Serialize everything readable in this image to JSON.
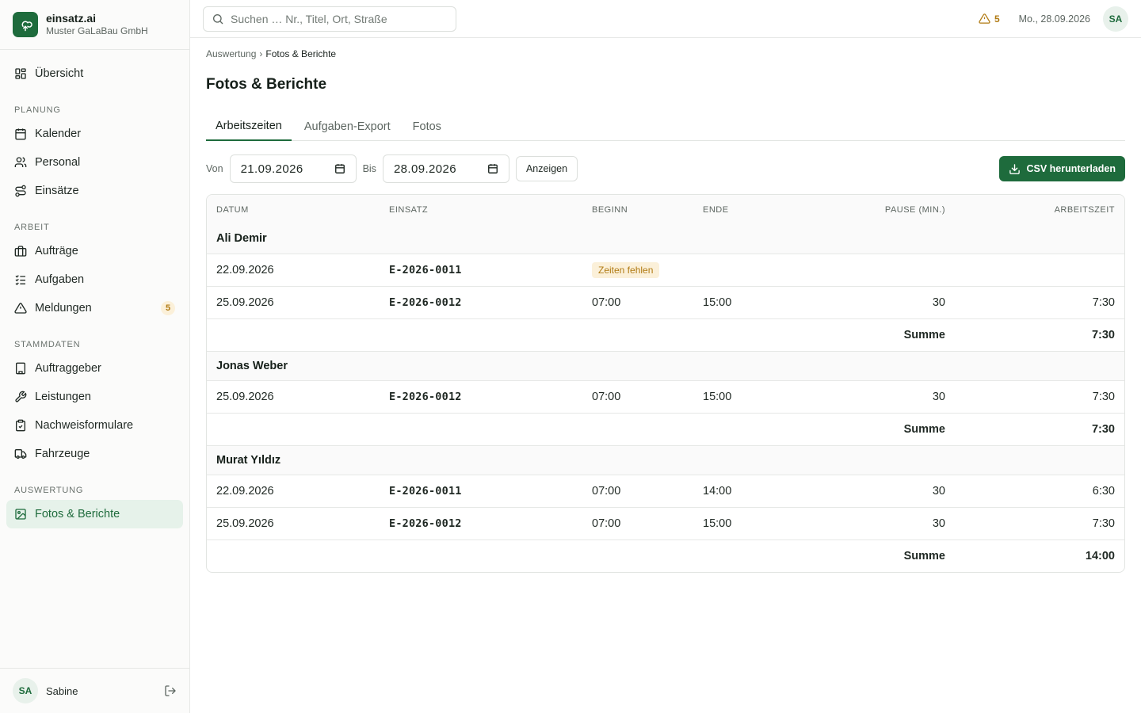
{
  "brand": {
    "name": "einsatz.ai",
    "company": "Muster GaLaBau GmbH"
  },
  "nav": {
    "overview": "Übersicht",
    "sections": {
      "planung": "PLANUNG",
      "arbeit": "ARBEIT",
      "stammdaten": "STAMMDATEN",
      "auswertung": "AUSWERTUNG"
    },
    "kalender": "Kalender",
    "personal": "Personal",
    "einsaetze": "Einsätze",
    "auftraege": "Aufträge",
    "aufgaben": "Aufgaben",
    "meldungen": "Meldungen",
    "meldungen_badge": "5",
    "auftraggeber": "Auftraggeber",
    "leistungen": "Leistungen",
    "nachweisformulare": "Nachweisformulare",
    "fahrzeuge": "Fahrzeuge",
    "fotos": "Fotos & Berichte"
  },
  "user": {
    "initials": "SA",
    "name": "Sabine"
  },
  "topbar": {
    "search_placeholder": "Suchen … Nr., Titel, Ort, Straße",
    "alert_count": "5",
    "date": "Mo., 28.09.2026"
  },
  "breadcrumb": {
    "parent": "Auswertung",
    "separator": "›",
    "current": "Fotos & Berichte"
  },
  "page_title": "Fotos & Berichte",
  "tabs": [
    "Arbeitszeiten",
    "Aufgaben-Export",
    "Fotos"
  ],
  "filters": {
    "from_label": "Von",
    "from_value": "21.09.2026",
    "to_label": "Bis",
    "to_value": "28.09.2026",
    "show_button": "Anzeigen",
    "csv_button": "CSV herunterladen"
  },
  "table": {
    "columns": [
      "DATUM",
      "EINSATZ",
      "BEGINN",
      "ENDE",
      "PAUSE (MIN.)",
      "ARBEITSZEIT"
    ],
    "sum_label": "Summe",
    "groups": [
      {
        "name": "Ali Demir",
        "rows": [
          {
            "datum": "22.09.2026",
            "einsatz": "E-2026-0011",
            "badge": "Zeiten fehlen",
            "beginn": "",
            "ende": "",
            "pause": "",
            "zeit": ""
          },
          {
            "datum": "25.09.2026",
            "einsatz": "E-2026-0012",
            "badge": "",
            "beginn": "07:00",
            "ende": "15:00",
            "pause": "30",
            "zeit": "7:30"
          }
        ],
        "total": "7:30"
      },
      {
        "name": "Jonas Weber",
        "rows": [
          {
            "datum": "25.09.2026",
            "einsatz": "E-2026-0012",
            "badge": "",
            "beginn": "07:00",
            "ende": "15:00",
            "pause": "30",
            "zeit": "7:30"
          }
        ],
        "total": "7:30"
      },
      {
        "name": "Murat Yıldız",
        "rows": [
          {
            "datum": "22.09.2026",
            "einsatz": "E-2026-0011",
            "badge": "",
            "beginn": "07:00",
            "ende": "14:00",
            "pause": "30",
            "zeit": "6:30"
          },
          {
            "datum": "25.09.2026",
            "einsatz": "E-2026-0012",
            "badge": "",
            "beginn": "07:00",
            "ende": "15:00",
            "pause": "30",
            "zeit": "7:30"
          }
        ],
        "total": "14:00"
      }
    ]
  },
  "colors": {
    "accent": "#1e6b3c",
    "warning": "#b07a12",
    "warning_bg": "#fbf0d9"
  }
}
